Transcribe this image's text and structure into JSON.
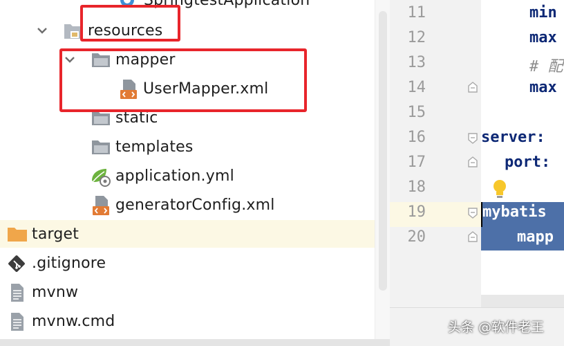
{
  "tree": {
    "items": [
      {
        "label": "SpringtestApplication",
        "kind": "java-class"
      },
      {
        "label": "resources",
        "kind": "folder",
        "expanded": true
      },
      {
        "label": "mapper",
        "kind": "folder",
        "expanded": true
      },
      {
        "label": "UserMapper.xml",
        "kind": "xml-file"
      },
      {
        "label": "static",
        "kind": "folder"
      },
      {
        "label": "templates",
        "kind": "folder"
      },
      {
        "label": "application.yml",
        "kind": "yml-file"
      },
      {
        "label": "generatorConfig.xml",
        "kind": "xml-file"
      },
      {
        "label": "target",
        "kind": "folder-excluded",
        "selected": true
      },
      {
        "label": ".gitignore",
        "kind": "git-file"
      },
      {
        "label": "mvnw",
        "kind": "text-file"
      },
      {
        "label": "mvnw.cmd",
        "kind": "text-file"
      }
    ]
  },
  "editor": {
    "line_numbers": [
      "11",
      "12",
      "13",
      "14",
      "15",
      "16",
      "17",
      "18",
      "19",
      "20"
    ],
    "lines": [
      "min",
      "max",
      "# 配",
      "max",
      "",
      "server:",
      "port:",
      "",
      "mybatis",
      "mapp"
    ],
    "current_line": "19"
  },
  "watermark": "头条 @软件老王",
  "colors": {
    "annotation": "#e8252b",
    "selection": "#4d70a8",
    "keyword": "#0d2875",
    "highlight_row": "#fcf8e4"
  }
}
